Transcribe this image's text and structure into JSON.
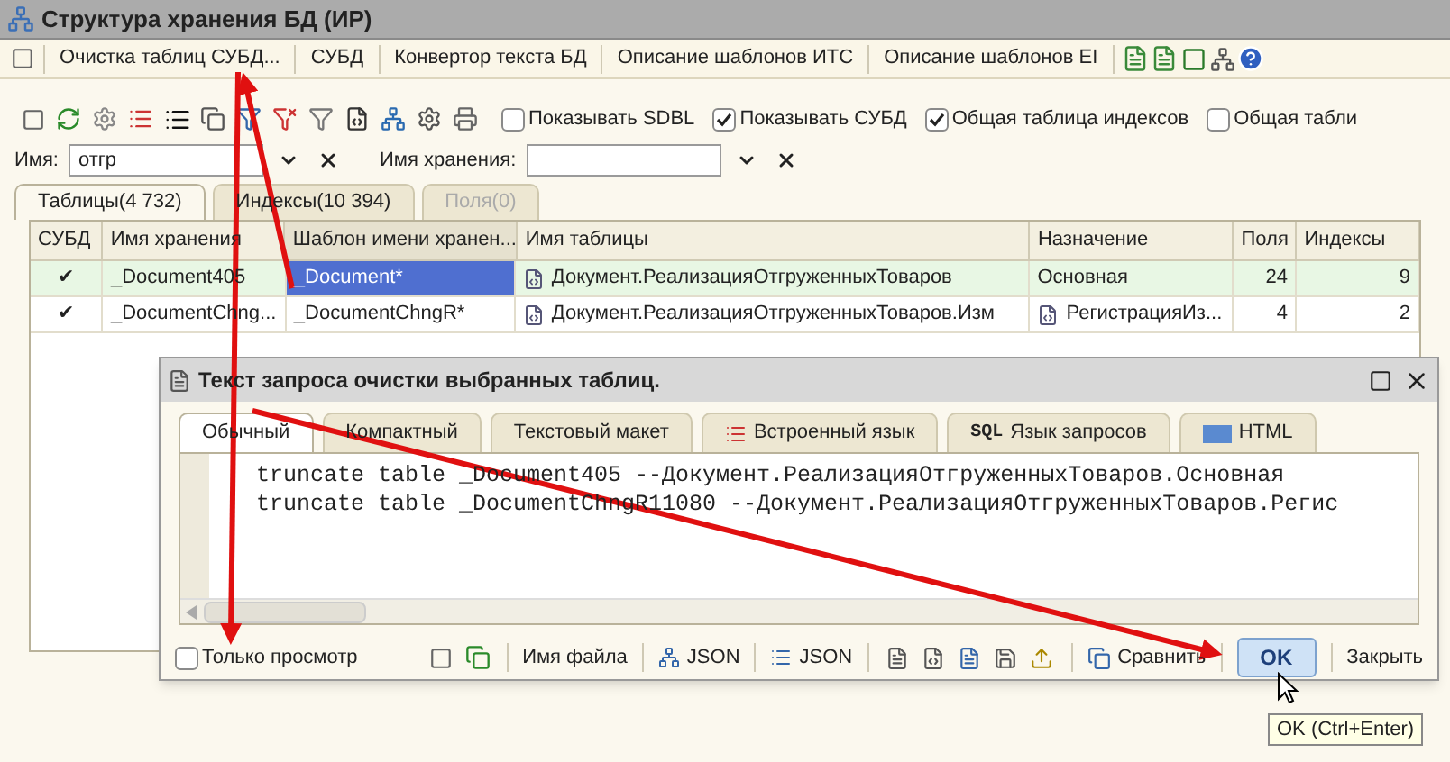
{
  "window": {
    "title": "Структура хранения БД (ИР)"
  },
  "menu": [
    "Очистка таблиц СУБД...",
    "СУБД",
    "Конвертор текста БД",
    "Описание шаблонов ИТС",
    "Описание шаблонов EI"
  ],
  "options": [
    {
      "label": "Показывать SDBL",
      "checked": false
    },
    {
      "label": "Показывать СУБД",
      "checked": true
    },
    {
      "label": "Общая таблица индексов",
      "checked": true
    },
    {
      "label": "Общая табли",
      "checked": false
    }
  ],
  "filters": [
    {
      "label": "Имя:",
      "value": "отгр"
    },
    {
      "label": "Имя хранения:"
    }
  ],
  "tabs": [
    {
      "label": "Таблицы(4 732)",
      "selected": true,
      "disabled": false
    },
    {
      "label": "Индексы(10 394)",
      "selected": false,
      "disabled": false
    },
    {
      "label": "Поля(0)",
      "selected": false,
      "disabled": true
    }
  ],
  "table": {
    "columns": [
      "СУБД",
      "Имя хранения",
      "Шаблон имени хранен...",
      "Имя таблицы",
      "Назначение",
      "Поля",
      "Индексы"
    ],
    "rows": [
      {
        "selected": true,
        "cells": [
          {
            "text": "✔",
            "selected": false,
            "icon": false
          },
          {
            "text": "_Document405",
            "selected": false,
            "icon": false
          },
          {
            "text": "_Document*",
            "selected": true,
            "icon": false
          },
          {
            "text": "Документ.РеализацияОтгруженныхТоваров",
            "selected": false,
            "icon": true
          },
          {
            "text": "Основная",
            "selected": false,
            "icon": false
          },
          {
            "text": "24",
            "selected": false,
            "icon": false
          },
          {
            "text": "9",
            "selected": false,
            "icon": false
          }
        ]
      },
      {
        "selected": false,
        "cells": [
          {
            "text": "✔",
            "selected": false,
            "icon": false
          },
          {
            "text": "_DocumentChng...",
            "selected": false,
            "icon": false
          },
          {
            "text": "_DocumentChngR*",
            "selected": false,
            "icon": false
          },
          {
            "text": "Документ.РеализацияОтгруженныхТоваров.Изм",
            "selected": false,
            "icon": true
          },
          {
            "text": "РегистрацияИз...",
            "selected": false,
            "icon": true
          },
          {
            "text": "4",
            "selected": false,
            "icon": false
          },
          {
            "text": "2",
            "selected": false,
            "icon": false
          }
        ]
      }
    ]
  },
  "dialog": {
    "title": "Текст запроса очистки выбранных таблиц.",
    "tabs": [
      {
        "label": "Обычный",
        "selected": true,
        "kind": "plain"
      },
      {
        "label": "Компактный",
        "selected": false,
        "kind": "plain"
      },
      {
        "label": "Текстовый макет",
        "selected": false,
        "kind": "plain"
      },
      {
        "label": "Встроенный язык",
        "selected": false,
        "kind": "lines"
      },
      {
        "label": "Язык запросов",
        "selected": false,
        "kind": "sql",
        "badge": "SQL"
      },
      {
        "label": "HTML",
        "selected": false,
        "kind": "html"
      }
    ],
    "code": [
      "truncate table _Document405 --Документ.РеализацияОтгруженныхТоваров.Основная",
      "truncate table _DocumentChngR11080 --Документ.РеализацияОтгруженныхТоваров.Регис"
    ],
    "read_only": {
      "label": "Только просмотр",
      "checked": false
    },
    "buttons": [
      {
        "label": "Имя файла",
        "kind": "text"
      },
      {
        "label": "JSON",
        "kind": "tree"
      },
      {
        "label": "JSON",
        "kind": "lines"
      },
      {
        "label": "Сравнить",
        "kind": "compare"
      }
    ],
    "ok": "OK",
    "close": "Закрыть",
    "tooltip": "OK (Ctrl+Enter)"
  }
}
